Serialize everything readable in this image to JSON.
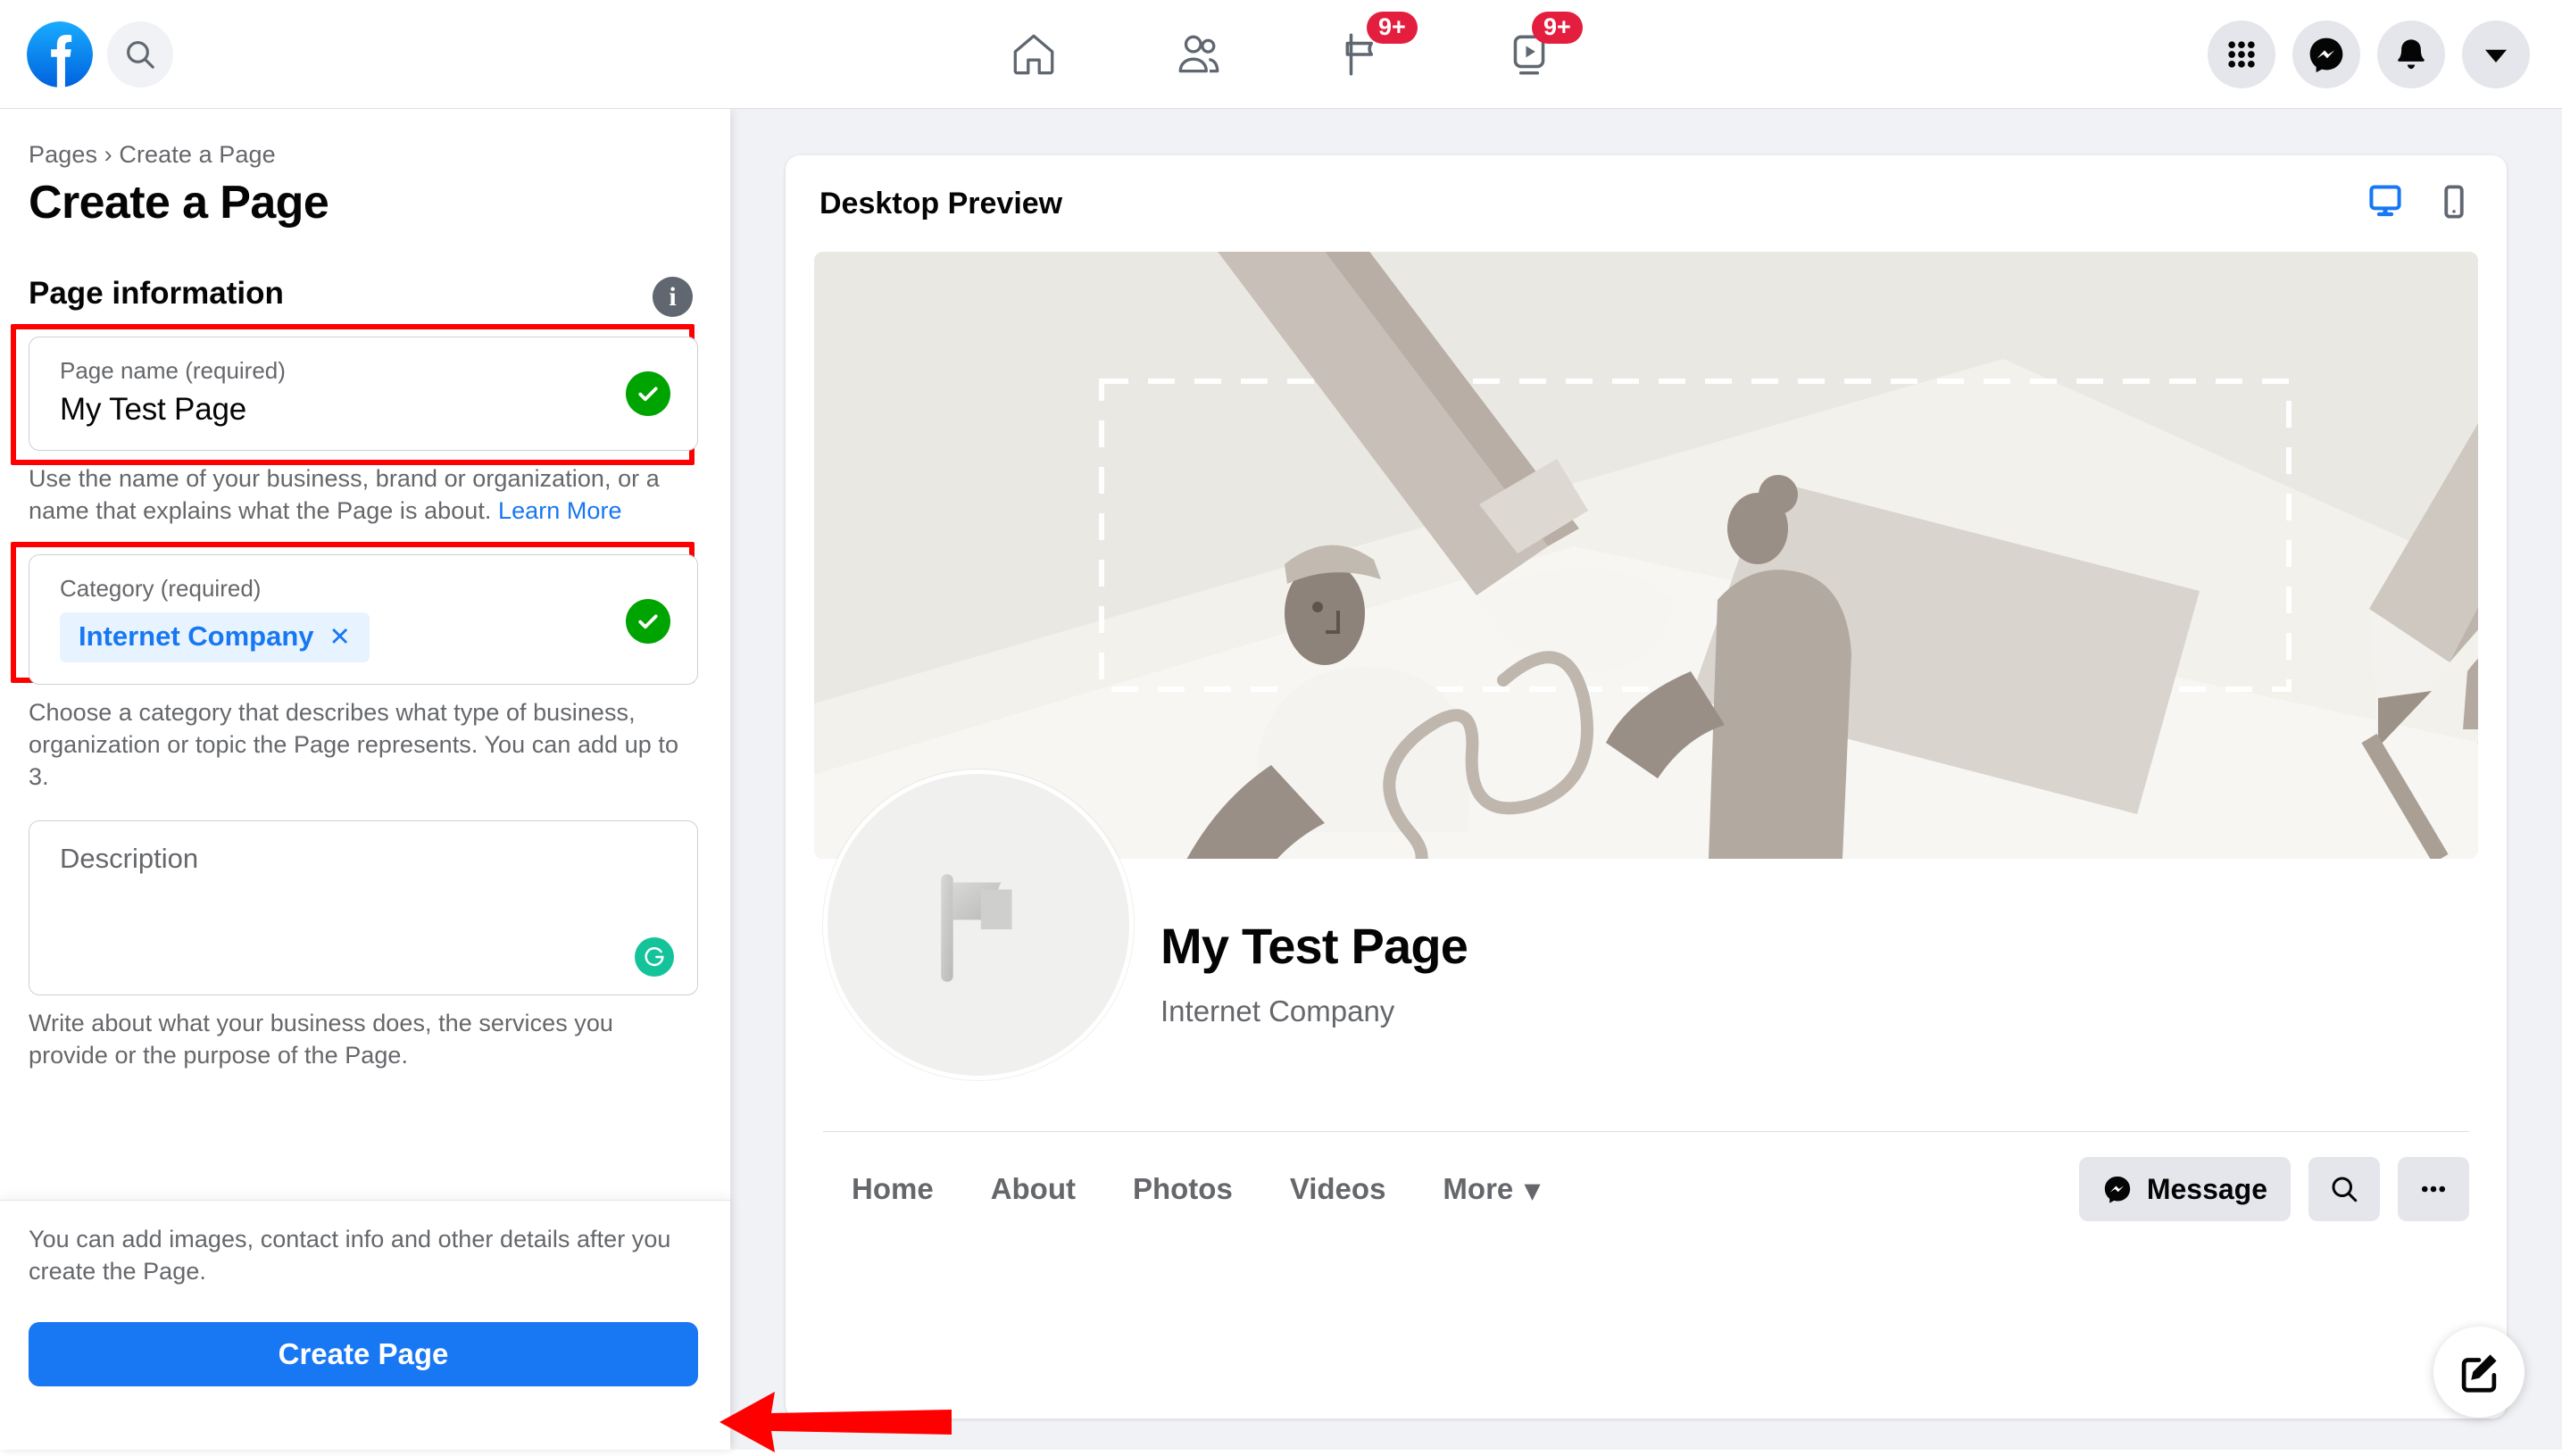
{
  "topnav": {
    "logo_icon": "facebook-logo",
    "search_icon": "search-icon",
    "tabs": [
      {
        "icon": "home-icon",
        "badge": ""
      },
      {
        "icon": "friends-icon",
        "badge": ""
      },
      {
        "icon": "flag-pages-icon",
        "badge": "9+"
      },
      {
        "icon": "watch-video-icon",
        "badge": "9+"
      }
    ],
    "right_buttons": [
      {
        "icon": "grid-menu-icon"
      },
      {
        "icon": "messenger-icon"
      },
      {
        "icon": "bell-notifications-icon"
      },
      {
        "icon": "chevron-down-account-icon"
      }
    ]
  },
  "left_panel": {
    "breadcrumb": "Pages › Create a Page",
    "title": "Create a Page",
    "info_icon": "info-icon",
    "section_title": "Page information",
    "page_name_field": {
      "label": "Page name (required)",
      "value": "My Test Page",
      "valid_icon": "green-check-icon",
      "helper": "Use the name of your business, brand or organization, or a name that explains what the Page is about. ",
      "helper_link": "Learn More"
    },
    "category_field": {
      "label": "Category (required)",
      "chip": "Internet Company",
      "chip_remove_icon": "close-x-icon",
      "valid_icon": "green-check-icon",
      "helper": "Choose a category that describes what type of business, organization or topic the Page represents. You can add up to 3."
    },
    "description_field": {
      "placeholder": "Description",
      "grammarly_icon": "grammarly-icon",
      "helper": "Write about what your business does, the services you provide or the purpose of the Page."
    },
    "footer": {
      "note": "You can add images, contact info and other details after you create the Page.",
      "create_button": "Create Page"
    }
  },
  "preview": {
    "title": "Desktop Preview",
    "desktop_toggle_icon": "desktop-monitor-icon",
    "mobile_toggle_icon": "mobile-phone-icon",
    "cover_alt": "cover-illustration",
    "avatar_icon": "flag-placeholder-icon",
    "page_name": "My Test Page",
    "page_category": "Internet Company",
    "tabs": [
      {
        "label": "Home"
      },
      {
        "label": "About"
      },
      {
        "label": "Photos"
      },
      {
        "label": "Videos"
      },
      {
        "label": "More",
        "caret": "▾"
      }
    ],
    "actions": {
      "message_label": "Message",
      "message_icon": "messenger-icon",
      "search_icon": "search-icon",
      "more_icon": "ellipsis-icon"
    },
    "fab_icon": "edit-compose-icon"
  },
  "annotations": {
    "highlight_color": "#ff0000",
    "arrow_icon": "red-left-arrow",
    "highlighted_fields": [
      "page-name-field",
      "category-field"
    ],
    "arrow_target": "create-page-button"
  },
  "colors": {
    "facebook_blue": "#1877f2",
    "badge_red": "#e41e3f",
    "valid_green": "#00a400",
    "chip_bg": "#e7f3ff",
    "grammarly_green": "#15c39a",
    "page_bg": "#f0f2f5"
  }
}
